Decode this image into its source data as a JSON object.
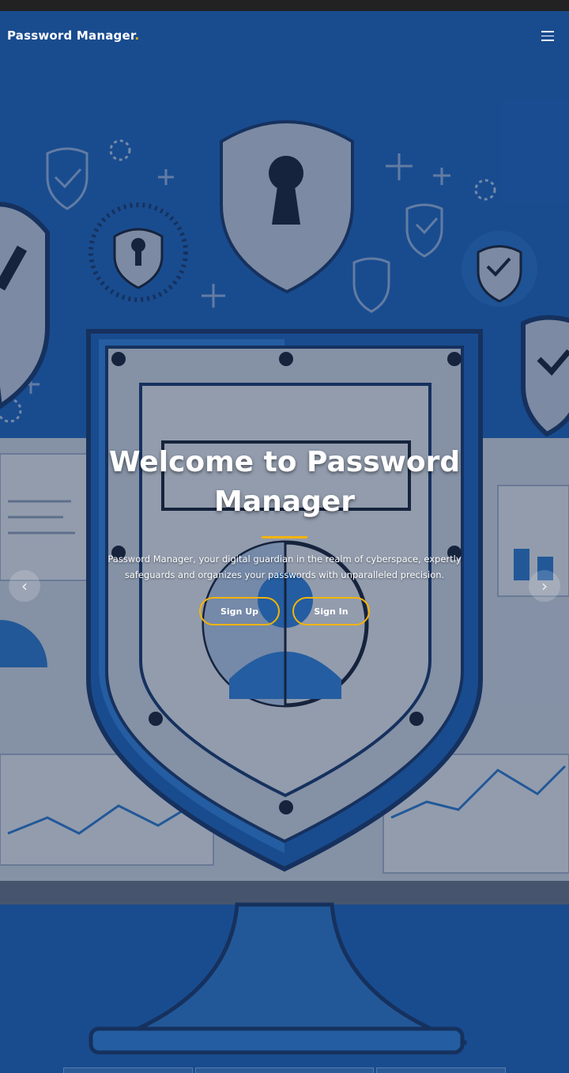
{
  "navbar": {
    "brand_text": "Password Manager",
    "brand_dot": ".",
    "menu_icon": "hamburger-menu-icon"
  },
  "hero": {
    "title": "Welcome to Password Manager",
    "description": "Password Manager, your digital guardian in the realm of cyberspace, expertly safeguards and organizes your passwords with unparalleled precision.",
    "signup_label": "Sign Up",
    "signin_label": "Sign In",
    "prev_icon": "chevron-left-icon",
    "next_icon": "chevron-right-icon",
    "prev_glyph": "‹",
    "next_glyph": "›"
  },
  "colors": {
    "accent": "#f5b400",
    "hero_blue": "#1f63b8",
    "light_panel": "#a8b9d3"
  }
}
